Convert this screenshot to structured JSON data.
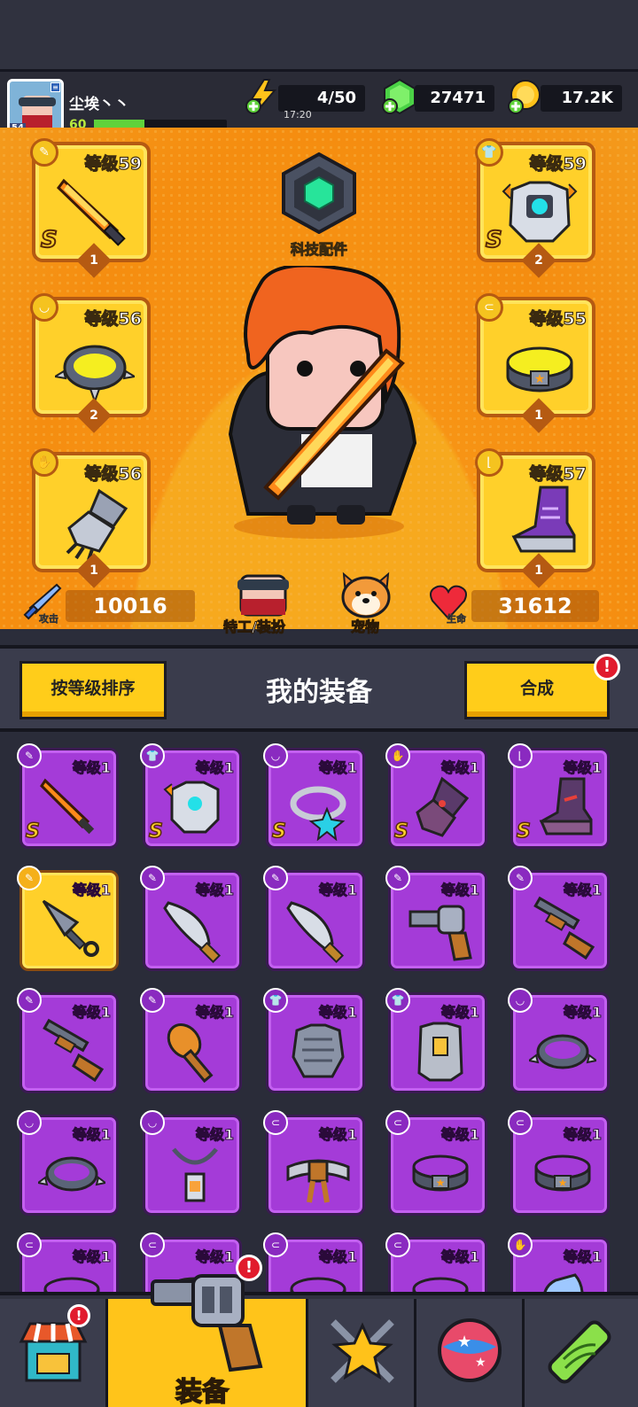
{
  "player": {
    "name": "尘埃丶丶",
    "avatar_level": "54",
    "level": "60",
    "xp_fraction": 0.38
  },
  "resources": {
    "energy": "4/50",
    "energy_timer": "17:20",
    "gems": "27471",
    "coins": "17.2K"
  },
  "hero": {
    "tech_label": "科技配件",
    "equipped": [
      {
        "slot": "weapon",
        "level": "等级59",
        "rank": "S",
        "count": "1"
      },
      {
        "slot": "armor",
        "level": "等级59",
        "rank": "S",
        "count": "2"
      },
      {
        "slot": "necklace",
        "level": "等级56",
        "rank": "",
        "count": "2"
      },
      {
        "slot": "belt",
        "level": "等级55",
        "rank": "",
        "count": "1"
      },
      {
        "slot": "gloves",
        "level": "等级56",
        "rank": "",
        "count": "1"
      },
      {
        "slot": "boots",
        "level": "等级57",
        "rank": "",
        "count": "1"
      }
    ],
    "attack_label": "攻击",
    "attack_value": "10016",
    "hp_label": "生命",
    "hp_value": "31612",
    "agent_label": "特工/装扮",
    "pet_label": "宠物"
  },
  "section": {
    "sort_button": "按等级排序",
    "title": "我的装备",
    "merge_button": "合成",
    "alert": "!"
  },
  "inventory": [
    {
      "level": "等级1",
      "rank": "S",
      "type": "weapon",
      "item": "sword-icon"
    },
    {
      "level": "等级1",
      "rank": "S",
      "type": "armor",
      "item": "mech-armor-icon"
    },
    {
      "level": "等级1",
      "rank": "S",
      "type": "necklace",
      "item": "star-ring-icon"
    },
    {
      "level": "等级1",
      "rank": "S",
      "type": "gloves",
      "item": "gauntlet-icon"
    },
    {
      "level": "等级1",
      "rank": "S",
      "type": "boots",
      "item": "boot-icon"
    },
    {
      "level": "等级1",
      "rank": "",
      "type": "weapon",
      "item": "kunai-icon",
      "gold": true
    },
    {
      "level": "等级1",
      "rank": "",
      "type": "weapon",
      "item": "machete-icon"
    },
    {
      "level": "等级1",
      "rank": "",
      "type": "weapon",
      "item": "machete-icon"
    },
    {
      "level": "等级1",
      "rank": "",
      "type": "weapon",
      "item": "revolver-icon"
    },
    {
      "level": "等级1",
      "rank": "",
      "type": "weapon",
      "item": "shotgun-icon"
    },
    {
      "level": "等级1",
      "rank": "",
      "type": "weapon",
      "item": "shotgun-icon"
    },
    {
      "level": "等级1",
      "rank": "",
      "type": "weapon",
      "item": "club-icon"
    },
    {
      "level": "等级1",
      "rank": "",
      "type": "armor",
      "item": "chainmail-icon"
    },
    {
      "level": "等级1",
      "rank": "",
      "type": "armor",
      "item": "vest-icon"
    },
    {
      "level": "等级1",
      "rank": "",
      "type": "necklace",
      "item": "spiked-collar-icon"
    },
    {
      "level": "等级1",
      "rank": "",
      "type": "necklace",
      "item": "spiked-collar-icon"
    },
    {
      "level": "等级1",
      "rank": "",
      "type": "necklace",
      "item": "tag-necklace-icon"
    },
    {
      "level": "等级1",
      "rank": "",
      "type": "belt",
      "item": "cloth-belt-icon"
    },
    {
      "level": "等级1",
      "rank": "",
      "type": "belt",
      "item": "star-belt-icon"
    },
    {
      "level": "等级1",
      "rank": "",
      "type": "belt",
      "item": "star-belt-icon"
    },
    {
      "level": "等级1",
      "rank": "",
      "type": "belt",
      "item": "belt-icon"
    },
    {
      "level": "等级1",
      "rank": "",
      "type": "belt",
      "item": "belt-icon"
    },
    {
      "level": "等级1",
      "rank": "",
      "type": "belt",
      "item": "belt-icon"
    },
    {
      "level": "等级1",
      "rank": "",
      "type": "belt",
      "item": "belt-icon"
    },
    {
      "level": "等级1",
      "rank": "",
      "type": "gloves",
      "item": "glove-icon"
    }
  ],
  "nav": {
    "active_label": "装备",
    "alert": "!"
  },
  "colors": {
    "accent": "#ffcd1a",
    "rare_purple": "#a43bd8",
    "hero_bg": "#f58d10",
    "alert_red": "#e11b2d"
  }
}
